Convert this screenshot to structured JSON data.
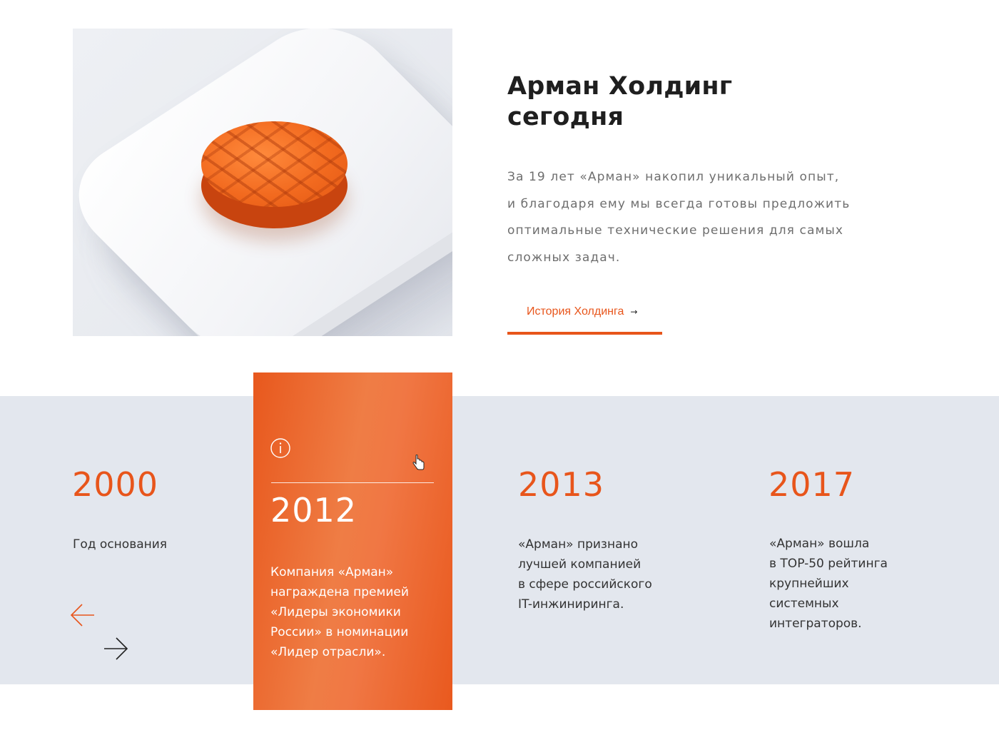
{
  "about": {
    "title_line1": "Арман Холдинг",
    "title_line2": "сегодня",
    "description": [
      "За 19 лет «Арман» накопил уникальный опыт,",
      "и благодаря ему мы всегда готовы предложить",
      "оптимальные технические решения для самых",
      "сложных задач."
    ],
    "history_link": {
      "label": "История Холдинга",
      "arrow": "→"
    }
  },
  "colors": {
    "accent": "#e8551b",
    "band": "#e3e7ee",
    "text": "#1f1f1f"
  },
  "timeline": {
    "items": [
      {
        "year": "2000",
        "text": [
          "Год основания"
        ]
      },
      {
        "year": "2012",
        "active": true,
        "text": [
          "Компания «Арман»",
          "награждена премией",
          "«Лидеры экономики",
          "России» в номинации",
          "«Лидер отрасли»."
        ]
      },
      {
        "year": "2013",
        "text": [
          "«Арман» признано",
          "лучшей компанией",
          "в сфере российского",
          "IT-инжиниринга."
        ]
      },
      {
        "year": "2017",
        "text": [
          "«Арман» вошла",
          "в TOP-50 рейтинга",
          "крупнейших",
          "системных",
          "интеграторов."
        ]
      }
    ],
    "nav": {
      "prev_icon": "arrow-left-icon",
      "next_icon": "arrow-right-icon"
    }
  },
  "icons": {
    "info": "info-icon",
    "cursor": "hand-cursor-icon"
  }
}
